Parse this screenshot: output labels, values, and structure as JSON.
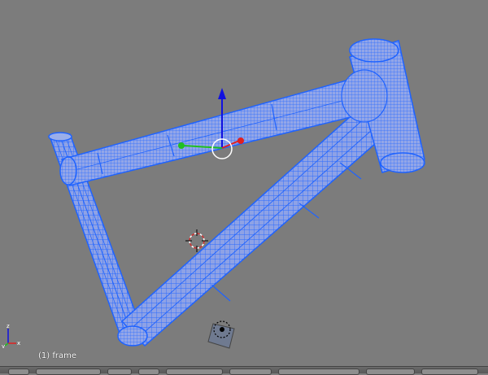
{
  "viewport": {
    "object_label": "(1) frame",
    "background_color": "#7c7c7c",
    "mesh_color": "#8ea2e6",
    "wire_color": "#1f63ff",
    "selected_object": "frame"
  },
  "gizmo": {
    "x_color": "#e02020",
    "y_color": "#20c020",
    "z_color": "#1010e0"
  },
  "axis_widget": {
    "x_label": "x",
    "y_label": "y",
    "z_label": "z"
  },
  "header": {
    "icons": [
      "view-menu-icon",
      "mode-select-icon",
      "shading-icon",
      "pivot-icon",
      "manipulator-icon",
      "layer-icon",
      "snap-icon",
      "render-icon"
    ]
  }
}
